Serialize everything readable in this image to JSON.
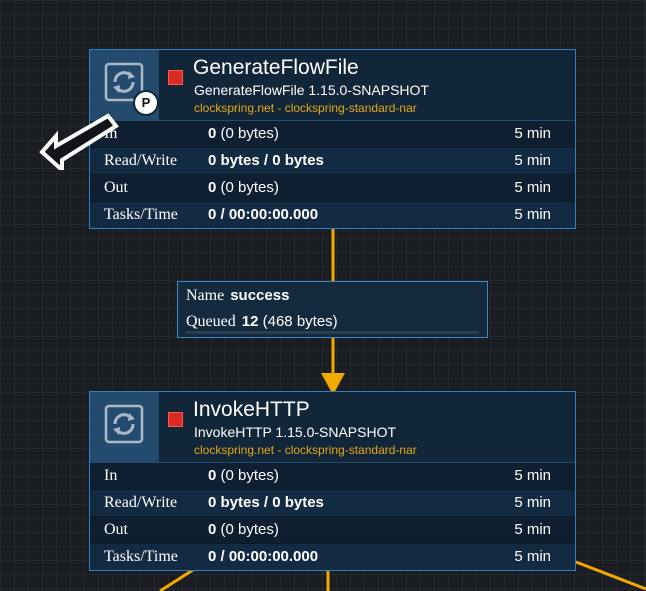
{
  "colors": {
    "connection": "#f2a900",
    "processor_bg": "#112638",
    "processor_border": "#2f80c0",
    "bundle_text": "#e6a817",
    "stopped": "#d82b24"
  },
  "processors": [
    {
      "name": "GenerateFlowFile",
      "type": "GenerateFlowFile 1.15.0-SNAPSHOT",
      "bundle": "clockspring.net - clockspring-standard-nar",
      "icon": "processor-icon",
      "status_icon": "stopped-icon",
      "primary_badge": "P",
      "stats": [
        {
          "label": "In",
          "value_bold": "0",
          "value_rest": " (0 bytes)",
          "window": "5 min"
        },
        {
          "label": "Read/Write",
          "value_bold": "0 bytes / 0 bytes",
          "value_rest": "",
          "window": "5 min"
        },
        {
          "label": "Out",
          "value_bold": "0",
          "value_rest": " (0 bytes)",
          "window": "5 min"
        },
        {
          "label": "Tasks/Time",
          "value_bold": "0 / 00:00:00.000",
          "value_rest": "",
          "window": "5 min"
        }
      ]
    },
    {
      "name": "InvokeHTTP",
      "type": "InvokeHTTP 1.15.0-SNAPSHOT",
      "bundle": "clockspring.net - clockspring-standard-nar",
      "icon": "processor-icon",
      "status_icon": "stopped-icon",
      "stats": [
        {
          "label": "In",
          "value_bold": "0",
          "value_rest": " (0 bytes)",
          "window": "5 min"
        },
        {
          "label": "Read/Write",
          "value_bold": "0 bytes / 0 bytes",
          "value_rest": "",
          "window": "5 min"
        },
        {
          "label": "Out",
          "value_bold": "0",
          "value_rest": " (0 bytes)",
          "window": "5 min"
        },
        {
          "label": "Tasks/Time",
          "value_bold": "0 / 00:00:00.000",
          "value_rest": "",
          "window": "5 min"
        }
      ]
    }
  ],
  "connection": {
    "name_label": "Name",
    "name_value": "success",
    "queued_label": "Queued",
    "queued_count": "12",
    "queued_size": "(468 bytes)",
    "queue_fill_fraction": 0
  }
}
